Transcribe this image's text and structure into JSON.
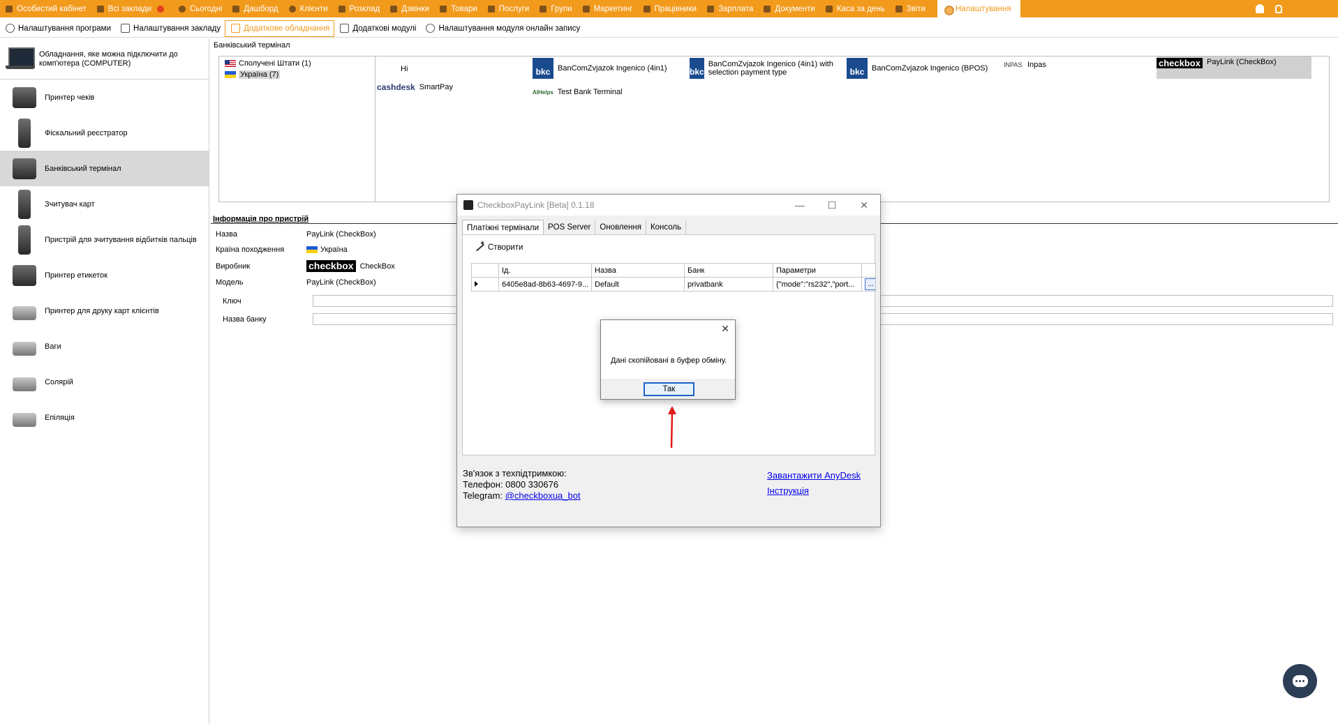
{
  "topnav": {
    "items": [
      {
        "label": "Особистий кабінет",
        "icon": "cabinet-icon"
      },
      {
        "label": "Всі заклади",
        "icon": "buildings-icon"
      },
      {
        "label": "Сьогодні",
        "icon": "today-icon"
      },
      {
        "label": "Дашборд",
        "icon": "dashboard-icon"
      },
      {
        "label": "Клієнти",
        "icon": "clients-icon"
      },
      {
        "label": "Розклад",
        "icon": "schedule-icon"
      },
      {
        "label": "Дзвінки",
        "icon": "calls-icon"
      },
      {
        "label": "Товари",
        "icon": "goods-icon"
      },
      {
        "label": "Послуги",
        "icon": "services-icon"
      },
      {
        "label": "Групи",
        "icon": "groups-icon"
      },
      {
        "label": "Маркетинг",
        "icon": "marketing-icon"
      },
      {
        "label": "Працівники",
        "icon": "employees-icon"
      },
      {
        "label": "Зарплата",
        "icon": "salary-icon"
      },
      {
        "label": "Документи",
        "icon": "documents-icon"
      },
      {
        "label": "Каса за день",
        "icon": "cashbox-icon"
      },
      {
        "label": "Звіти",
        "icon": "reports-icon"
      }
    ],
    "active": {
      "label": "Налаштування",
      "icon": "gear-icon"
    },
    "accent_color": "#f29a1c"
  },
  "subnav": {
    "tabs": [
      {
        "label": "Налаштування програми"
      },
      {
        "label": "Налаштування закладу"
      },
      {
        "label": "Додаткове обладнання"
      },
      {
        "label": "Додаткові модулі"
      },
      {
        "label": "Налаштування модуля онлайн запису"
      }
    ],
    "active_index": 2
  },
  "left": {
    "computer_label": "Обладнання, яке можна підключити до комп'ютера (COMPUTER)",
    "devices": [
      {
        "label": "Принтер чеків"
      },
      {
        "label": "Фіскальний реєстратор"
      },
      {
        "label": "Банківський термінал"
      },
      {
        "label": "Зчитувач карт"
      },
      {
        "label": "Пристрій для зчитування відбитків пальців"
      },
      {
        "label": "Принтер етикеток"
      },
      {
        "label": "Принтер для друку карт клієнтів"
      },
      {
        "label": "Ваги"
      },
      {
        "label": "Солярій"
      },
      {
        "label": "Епіляція"
      }
    ],
    "active_index": 2
  },
  "terminal_section": {
    "title": "Банківський термінал",
    "countries": [
      {
        "label": "Сполучені Штати (1)"
      },
      {
        "label": "Україна (7)"
      }
    ],
    "terminals": [
      {
        "logo": "",
        "name": "Hi"
      },
      {
        "logo": "bkc",
        "name": "BanComZvjazok Ingenico (4in1)"
      },
      {
        "logo": "bkc",
        "name": "BanComZvjazok Ingenico (4in1) with selection payment type"
      },
      {
        "logo": "bkc",
        "name": "BanComZvjazok Ingenico (BPOS)"
      },
      {
        "logo": "INPAS",
        "name": "Inpas"
      },
      {
        "logo": "checkbox",
        "name": "PayLink (CheckBox)"
      },
      {
        "logo": "cashdesk",
        "name": "SmartPay"
      },
      {
        "logo": "AIHelps",
        "name": "Test Bank Terminal"
      }
    ]
  },
  "info": {
    "title": "Інформація про пристрій",
    "rows": [
      {
        "key": "Назва",
        "value": "PayLink (CheckBox)"
      },
      {
        "key": "Країна походження",
        "value": "Україна"
      },
      {
        "key": "Виробник",
        "logo": "checkbox",
        "value": "CheckBox"
      },
      {
        "key": "Модель",
        "value": "PayLink (CheckBox)"
      }
    ],
    "fields": [
      {
        "label": "Ключ",
        "value": ""
      },
      {
        "label": "Назва банку",
        "value": ""
      }
    ]
  },
  "dialog": {
    "title": "CheckboxPayLink [Beta] 0.1.18",
    "tabs": [
      "Платіжні термінали",
      "POS Server",
      "Оновлення",
      "Консоль"
    ],
    "create_label": "Створити",
    "columns": [
      "Ід.",
      "Назва",
      "Банк",
      "Параметри"
    ],
    "rows": [
      {
        "id": "6405e8ad-8b63-4697-9...",
        "name": "Default",
        "bank": "privatbank",
        "params": "{\"mode\":\"rs232\",\"port...",
        "button": "..."
      }
    ],
    "support": {
      "title": "Зв'язок з техпідтримкою:",
      "phone": "Телефон: 0800 330676",
      "telegram_label": "Telegram:",
      "telegram_link": "@checkboxua_bot"
    },
    "links": [
      "Завантажити AnyDesk",
      "Інструкція"
    ]
  },
  "message_box": {
    "text": "Дані скопійовані в буфер обміну.",
    "ok_label": "Так",
    "close_symbol": "✕"
  },
  "window_buttons": {
    "minimize": "—",
    "maximize": "☐",
    "close": "✕"
  }
}
